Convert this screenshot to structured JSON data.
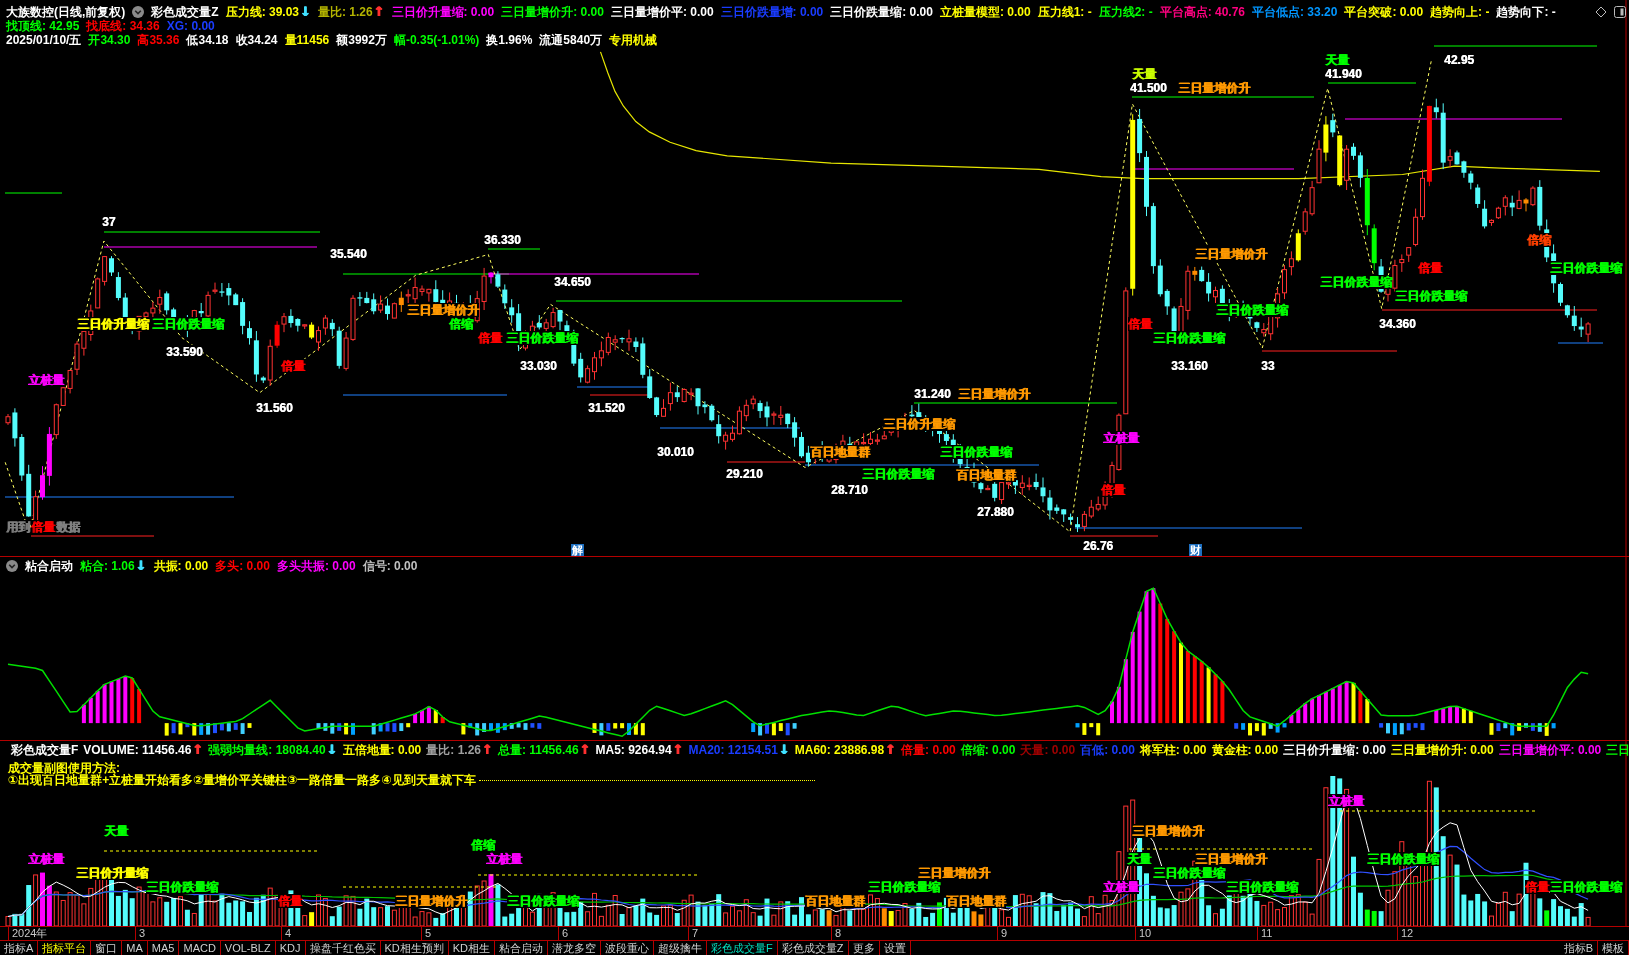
{
  "main_chart": {
    "title": "大族数控(日线,前复权)",
    "indicator_name": "彩色成交量Z",
    "indicators": [
      {
        "text": "压力线: 39.03",
        "color": "#ffff00",
        "arrow": {
          "text": "↓",
          "color": "#40e0ff"
        }
      },
      {
        "text": "量比: 1.26",
        "color": "#b4b400",
        "arrow": {
          "text": "↑",
          "color": "#ff3030"
        }
      },
      {
        "text": "三日价升量缩: 0.00",
        "color": "#ff00ff"
      },
      {
        "text": "三日量增价升: 0.00",
        "color": "#00ff00"
      },
      {
        "text": "三日量增价平: 0.00",
        "color": "#ffffff"
      },
      {
        "text": "三日价跌量增: 0.00",
        "color": "#1a3cff"
      },
      {
        "text": "三日价跌量缩: 0.00",
        "color": "#ffffff"
      },
      {
        "text": "立桩量模型: 0.00",
        "color": "#ffff00"
      },
      {
        "text": "压力线1: -",
        "color": "#ffff00"
      },
      {
        "text": "压力线2: -",
        "color": "#00ff00"
      },
      {
        "text": "平台高点: 40.76",
        "color": "#ff0080"
      },
      {
        "text": "平台低点: 33.20",
        "color": "#0096ff"
      },
      {
        "text": "平台突破: 0.00",
        "color": "#ffff00"
      },
      {
        "text": "趋势向上: -",
        "color": "#ffff00"
      },
      {
        "text": "趋势向下: -",
        "color": "#ffffff"
      }
    ],
    "signals": [
      {
        "text": "找顶线: 42.95",
        "color": "#00ff00"
      },
      {
        "text": "找底线: 34.36",
        "color": "#ff0000"
      },
      {
        "text": "XG: 0.00",
        "color": "#1a3cff"
      }
    ],
    "quote": [
      {
        "text": "2025/01/10/五",
        "color": "#ffffff"
      },
      {
        "text": "开34.30",
        "color": "#00ff00"
      },
      {
        "text": "高35.36",
        "color": "#ff0000"
      },
      {
        "text": "低34.18",
        "color": "#ffffff"
      },
      {
        "text": "收34.24",
        "color": "#ffffff"
      },
      {
        "text": "量11456",
        "color": "#ffff00"
      },
      {
        "text": "额3992万",
        "color": "#ffffff"
      },
      {
        "text": "幅-0.35(-1.01%)",
        "color": "#00ff00"
      },
      {
        "text": "换1.96%",
        "color": "#ffffff"
      },
      {
        "text": "流通5840万",
        "color": "#ffffff"
      },
      {
        "text": "专用机械",
        "color": "#ffff00"
      }
    ],
    "annotations": [
      {
        "text": "天量",
        "color": "#00ff00"
      },
      {
        "text": "42.95",
        "color": "#ffffff"
      },
      {
        "text": "天量",
        "color": "#ccff00"
      },
      {
        "text": "41.940",
        "color": "#ffffff"
      },
      {
        "text": "41.500",
        "color": "#ffffff"
      },
      {
        "text": "三日量增价升",
        "color": "#ff9900"
      },
      {
        "text": "37",
        "color": "#ffffff"
      },
      {
        "text": "36.330",
        "color": "#ffffff"
      },
      {
        "text": "倍缩",
        "color": "#ff4000"
      },
      {
        "text": "35.540",
        "color": "#ffffff"
      },
      {
        "text": "三日量增价升",
        "color": "#ff9900"
      },
      {
        "text": "倍量",
        "color": "#ff0000"
      },
      {
        "text": "三日价跌量缩",
        "color": "#00ff00"
      },
      {
        "text": "34.650",
        "color": "#ffffff"
      },
      {
        "text": "三日价跌量缩",
        "color": "#00ff00"
      },
      {
        "text": "三日价跌量缩",
        "color": "#00ff00"
      },
      {
        "text": "三日量增价升",
        "color": "#ff9900"
      },
      {
        "text": "三日价跌量缩",
        "color": "#00ff00"
      },
      {
        "text": "三日价升量缩",
        "color": "#ffff00"
      },
      {
        "text": "三日价跌量缩",
        "color": "#00ff00"
      },
      {
        "text": "倍缩",
        "color": "#00ff00"
      },
      {
        "text": "倍量",
        "color": "#ff0000"
      },
      {
        "text": "34.360",
        "color": "#ffffff"
      },
      {
        "text": "倍量",
        "color": "#ff0000"
      },
      {
        "text": "三日价跌量缩",
        "color": "#00ff00"
      },
      {
        "text": "三日价跌量缩",
        "color": "#00ff00"
      },
      {
        "text": "33.590",
        "color": "#ffffff"
      },
      {
        "text": "倍量",
        "color": "#ff0000"
      },
      {
        "text": "33.030",
        "color": "#ffffff"
      },
      {
        "text": "33.160",
        "color": "#ffffff"
      },
      {
        "text": "33",
        "color": "#ffffff"
      },
      {
        "text": "立桩量",
        "color": "#ff00ff"
      },
      {
        "text": "31.240",
        "color": "#ffffff"
      },
      {
        "text": "三日量增价升",
        "color": "#ff9900"
      },
      {
        "text": "31.560",
        "color": "#ffffff"
      },
      {
        "text": "31.520",
        "color": "#ffffff"
      },
      {
        "text": "三日价升量缩",
        "color": "#ff9900"
      },
      {
        "text": "立桩量",
        "color": "#ff00ff"
      },
      {
        "text": "30.010",
        "color": "#ffffff"
      },
      {
        "text": "百日地量群",
        "color": "#ff9900"
      },
      {
        "text": "三日价跌量缩",
        "color": "#00ff00"
      },
      {
        "text": "29.210",
        "color": "#ffffff"
      },
      {
        "text": "三日价跌量缩",
        "color": "#00ff00"
      },
      {
        "text": "百日地量群",
        "color": "#ff9900"
      },
      {
        "text": "28.710",
        "color": "#ffffff"
      },
      {
        "text": "倍量",
        "color": "#ff0000"
      },
      {
        "text": "27.880",
        "color": "#ffffff"
      },
      {
        "text": "用到",
        "color": "#808080"
      },
      {
        "text": "倍量",
        "color": "#ff0000"
      },
      {
        "text": "数据",
        "color": "#808080"
      },
      {
        "text": "26.76",
        "color": "#ffffff"
      }
    ],
    "events": [
      {
        "text": "解"
      },
      {
        "text": "财"
      }
    ]
  },
  "oscillator_panel": {
    "indicator_name": "粘合启动",
    "indicators": [
      {
        "text": "粘合: 1.06",
        "color": "#00ff00",
        "arrow": {
          "text": "↓",
          "color": "#40e0ff"
        }
      },
      {
        "text": "共振: 0.00",
        "color": "#ffff00"
      },
      {
        "text": "多头: 0.00",
        "color": "#ff0000"
      },
      {
        "text": "多头共振: 0.00",
        "color": "#ff00ff"
      },
      {
        "text": "信号: 0.00",
        "color": "#c0c0c0"
      }
    ]
  },
  "volume_panel": {
    "indicator_name": "彩色成交量F",
    "indicators": [
      {
        "text": "VOLUME: 11456.46",
        "color": "#ffffff",
        "arrow": {
          "text": "↑",
          "color": "#ff3030"
        }
      },
      {
        "text": "强弱均量线: 18084.40",
        "color": "#00ff00",
        "arrow": {
          "text": "↓",
          "color": "#40e0ff"
        }
      },
      {
        "text": "五倍地量: 0.00",
        "color": "#ffff00"
      },
      {
        "text": "量比: 1.26",
        "color": "#a0a0a0",
        "arrow": {
          "text": "↑",
          "color": "#ff3030"
        }
      },
      {
        "text": "总量: 11456.46",
        "color": "#00ff00",
        "arrow": {
          "text": "↑",
          "color": "#ff3030"
        }
      },
      {
        "text": "MA5: 9264.94",
        "color": "#ffffff",
        "arrow": {
          "text": "↑",
          "color": "#ff3030"
        }
      },
      {
        "text": "MA20: 12154.51",
        "color": "#1a3cff",
        "arrow": {
          "text": "↓",
          "color": "#40e0ff"
        }
      },
      {
        "text": "MA60: 23886.98",
        "color": "#ffff00",
        "arrow": {
          "text": "↑",
          "color": "#ff3030"
        }
      },
      {
        "text": "倍量: 0.00",
        "color": "#ff0000"
      },
      {
        "text": "倍缩: 0.00",
        "color": "#00ff00"
      },
      {
        "text": "天量: 0.00",
        "color": "#a00000"
      },
      {
        "text": "百低: 0.00",
        "color": "#1a3cff"
      },
      {
        "text": "将军柱: 0.00",
        "color": "#ffff00"
      },
      {
        "text": "黄金柱: 0.00",
        "color": "#ffff00"
      },
      {
        "text": "三日价升量缩: 0.00",
        "color": "#ffffff"
      },
      {
        "text": "三日量增价升: 0.00",
        "color": "#ffff00"
      },
      {
        "text": "三日量增价平: 0.00",
        "color": "#ff00ff"
      },
      {
        "text": "三日",
        "color": "#00ff00"
      }
    ],
    "usage_title": "成交量副图使用方法:",
    "usage_text": "①出现百日地量群+立桩量开始看多②量增价平关键柱③一路倍量一路多④见到天量就下车",
    "annotations": [
      {
        "text": "立桩量",
        "color": "#ff00ff"
      },
      {
        "text": "天量",
        "color": "#00ff00"
      },
      {
        "text": "三日量增价升",
        "color": "#ff9900"
      },
      {
        "text": "倍缩",
        "color": "#00ff00"
      },
      {
        "text": "立桩量",
        "color": "#ff00ff"
      },
      {
        "text": "立桩量",
        "color": "#ff00ff"
      },
      {
        "text": "天量",
        "color": "#00ff00"
      },
      {
        "text": "三日量增价升",
        "color": "#ff9900"
      },
      {
        "text": "三日价跌量缩",
        "color": "#00ff00"
      },
      {
        "text": "三日价升量缩",
        "color": "#ffff00"
      },
      {
        "text": "三日量增价升",
        "color": "#ff9900"
      },
      {
        "text": "三日价跌量缩",
        "color": "#00ff00"
      },
      {
        "text": "三日价跌量缩",
        "color": "#00ff00"
      },
      {
        "text": "三日价跌量缩",
        "color": "#00ff00"
      },
      {
        "text": "立桩量",
        "color": "#ff00ff"
      },
      {
        "text": "三日价跌量缩",
        "color": "#00ff00"
      },
      {
        "text": "倍量",
        "color": "#ff0000"
      },
      {
        "text": "三日价跌量缩",
        "color": "#00ff00"
      },
      {
        "text": "倍量",
        "color": "#ff0000"
      },
      {
        "text": "三日量增价升",
        "color": "#ff9900"
      },
      {
        "text": "三日价跌量缩",
        "color": "#00ff00"
      },
      {
        "text": "百日地量群",
        "color": "#ff9900"
      },
      {
        "text": "百日地量群",
        "color": "#ff9900"
      }
    ]
  },
  "time_axis": {
    "labels": [
      "2024年",
      "3",
      "4",
      "5",
      "6",
      "7",
      "8",
      "9",
      "10",
      "11",
      "12"
    ]
  },
  "tab_bar": {
    "tabs": [
      {
        "label": "指标A",
        "selected": false,
        "accent": false
      },
      {
        "label": "指标平台",
        "selected": false,
        "accent": true
      },
      {
        "label": "窗口",
        "selected": false,
        "accent": false
      },
      {
        "label": "MA",
        "selected": false,
        "accent": false
      },
      {
        "label": "MA5",
        "selected": false,
        "accent": false
      },
      {
        "label": "MACD",
        "selected": false,
        "accent": false
      },
      {
        "label": "VOL-BLZ",
        "selected": false,
        "accent": false
      },
      {
        "label": "KDJ",
        "selected": false,
        "accent": false
      },
      {
        "label": "操盘千红色买",
        "selected": false,
        "accent": false
      },
      {
        "label": "KD相生预判",
        "selected": false,
        "accent": false
      },
      {
        "label": "KD相生",
        "selected": false,
        "accent": false
      },
      {
        "label": "粘合启动",
        "selected": false,
        "accent": false
      },
      {
        "label": "潜龙多空",
        "selected": false,
        "accent": false
      },
      {
        "label": "波段重心",
        "selected": false,
        "accent": false
      },
      {
        "label": "超级擒牛",
        "selected": false,
        "accent": false
      },
      {
        "label": "彩色成交量F",
        "selected": true,
        "accent": false
      },
      {
        "label": "彩色成交量Z",
        "selected": false,
        "accent": false
      },
      {
        "label": "更多",
        "selected": false,
        "accent": false
      },
      {
        "label": "设置",
        "selected": false,
        "accent": false
      }
    ],
    "right_tabs": [
      {
        "label": "指标B",
        "selected": false
      },
      {
        "label": "模板",
        "selected": false
      }
    ]
  }
}
